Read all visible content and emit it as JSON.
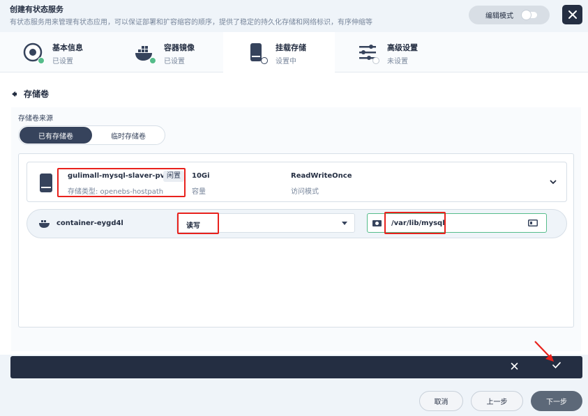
{
  "header": {
    "title": "创建有状态服务",
    "description": "有状态服务用来管理有状态应用，可以保证部署和扩容缩容的顺序，提供了稳定的持久化存储和网络标识，有序伸缩等",
    "edit_mode_label": "编辑模式"
  },
  "steps": [
    {
      "label": "基本信息",
      "status": "已设置",
      "icon": "gear-disc-icon"
    },
    {
      "label": "容器镜像",
      "status": "已设置",
      "icon": "docker-whale-icon"
    },
    {
      "label": "挂载存储",
      "status": "设置中",
      "icon": "disk-icon"
    },
    {
      "label": "高级设置",
      "status": "未设置",
      "icon": "sliders-icon"
    }
  ],
  "section_title": "存储卷",
  "volume_source": {
    "label": "存储卷来源",
    "options": [
      "已有存储卷",
      "临时存储卷"
    ],
    "selected": "已有存储卷"
  },
  "pvc": {
    "name": "gulimall-mysql-slaver-pvc",
    "badge": "闲置",
    "storage_type": "存储类型: openebs-hostpath",
    "capacity_value": "10Gi",
    "capacity_label": "容量",
    "access_mode_value": "ReadWriteOnce",
    "access_mode_label": "访问模式"
  },
  "mount": {
    "container_name": "container-eygd4l",
    "mode_value": "读写",
    "path_value": "/var/lib/mysql"
  },
  "footer": {
    "cancel_label": "取消",
    "prev_label": "上一步",
    "next_label": "下一步"
  },
  "colors": {
    "dark": "#242e42",
    "success": "#55bc8a",
    "highlight": "#e8211c"
  }
}
